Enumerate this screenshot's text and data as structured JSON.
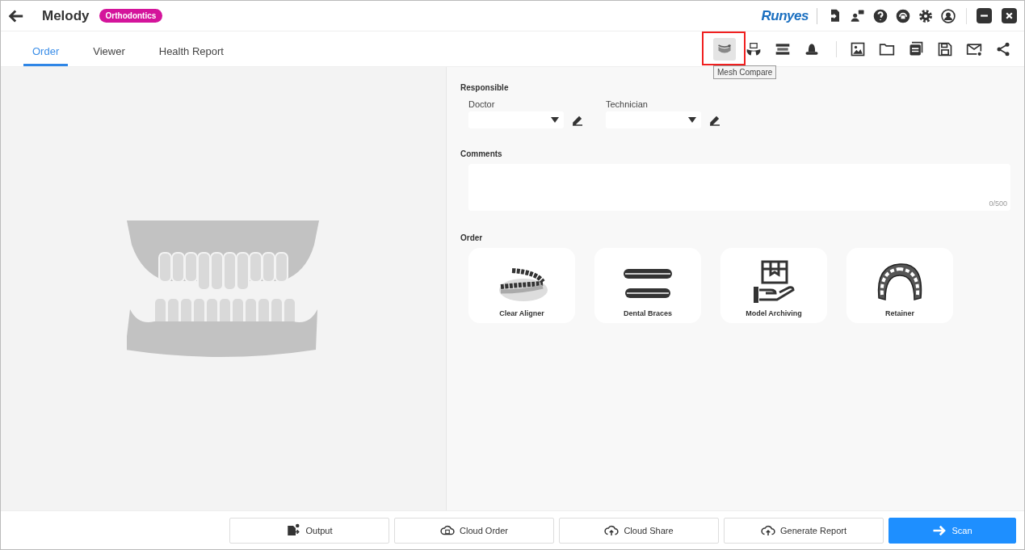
{
  "header": {
    "title": "Melody",
    "tag": "Orthodontics",
    "brand": "Runyes"
  },
  "window_icons": [
    {
      "kind": "import"
    },
    {
      "kind": "support"
    },
    {
      "kind": "help"
    },
    {
      "kind": "headset"
    },
    {
      "kind": "settings"
    },
    {
      "kind": "account"
    }
  ],
  "tabs": [
    {
      "label": "Order",
      "selected": true
    },
    {
      "label": "Viewer",
      "selected": false
    },
    {
      "label": "Health Report",
      "selected": false
    }
  ],
  "tools": [
    {
      "kind": "mesh",
      "highlighted": true,
      "tooltip": "Mesh Compare"
    },
    {
      "kind": "tooth",
      "highlighted": false
    },
    {
      "kind": "arch",
      "highlighted": false
    },
    {
      "kind": "bell",
      "highlighted": false
    }
  ],
  "file_tools": [
    {
      "kind": "image"
    },
    {
      "kind": "folder"
    },
    {
      "kind": "list"
    },
    {
      "kind": "save"
    },
    {
      "kind": "mail"
    },
    {
      "kind": "share"
    }
  ],
  "responsible": {
    "heading": "Responsible",
    "fields": [
      {
        "label": "Doctor"
      },
      {
        "label": "Technician"
      }
    ]
  },
  "comments": {
    "heading": "Comments",
    "counter": "0/500"
  },
  "order": {
    "heading": "Order",
    "items": [
      {
        "label": "Clear Aligner",
        "kind": "aligner"
      },
      {
        "label": "Dental Braces",
        "kind": "braces"
      },
      {
        "label": "Model Archiving",
        "kind": "archive"
      },
      {
        "label": "Retainer",
        "kind": "retainer"
      }
    ]
  },
  "bottom_buttons": [
    {
      "label": "Output",
      "kind": "output",
      "primary": false
    },
    {
      "label": "Cloud Order",
      "kind": "cloud-order",
      "primary": false
    },
    {
      "label": "Cloud Share",
      "kind": "cloud",
      "primary": false
    },
    {
      "label": "Generate Report",
      "kind": "cloud",
      "primary": false
    },
    {
      "label": "Scan",
      "kind": "arrow",
      "primary": true
    }
  ]
}
